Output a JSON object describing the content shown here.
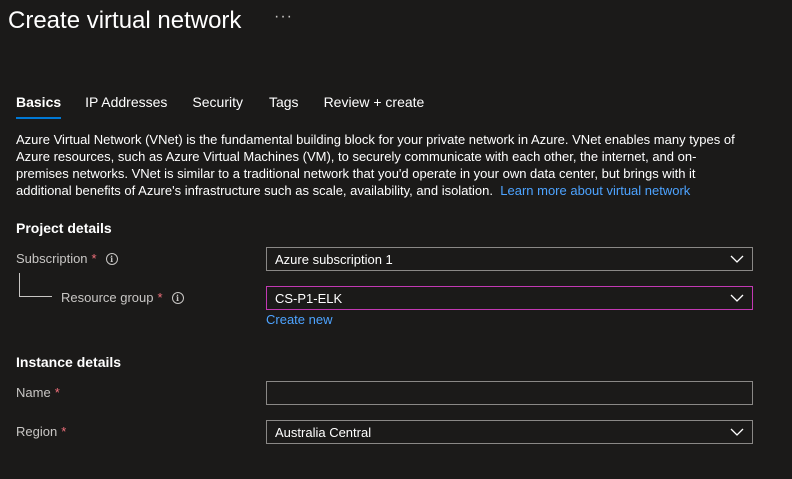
{
  "header": {
    "title": "Create virtual network",
    "more_label": "···"
  },
  "tabs": [
    {
      "label": "Basics",
      "active": true
    },
    {
      "label": "IP Addresses",
      "active": false
    },
    {
      "label": "Security",
      "active": false
    },
    {
      "label": "Tags",
      "active": false
    },
    {
      "label": "Review + create",
      "active": false
    }
  ],
  "description": {
    "text": "Azure Virtual Network (VNet) is the fundamental building block for your private network in Azure. VNet enables many types of Azure resources, such as Azure Virtual Machines (VM), to securely communicate with each other, the internet, and on-premises networks. VNet is similar to a traditional network that you'd operate in your own data center, but brings with it additional benefits of Azure's infrastructure such as scale, availability, and isolation.",
    "link": "Learn more about virtual network"
  },
  "project_details": {
    "heading": "Project details",
    "subscription": {
      "label": "Subscription",
      "required": "*",
      "value": "Azure subscription 1"
    },
    "resource_group": {
      "label": "Resource group",
      "required": "*",
      "value": "CS-P1-ELK",
      "create_new": "Create new"
    }
  },
  "instance_details": {
    "heading": "Instance details",
    "name": {
      "label": "Name",
      "required": "*",
      "value": "",
      "placeholder": ""
    },
    "region": {
      "label": "Region",
      "required": "*",
      "value": "Australia Central"
    }
  },
  "icons": {
    "info": "info-icon",
    "chevron": "chevron-down-icon",
    "more": "more-icon"
  },
  "colors": {
    "background": "#1b1a19",
    "accent": "#0078d4",
    "link": "#4da3ff",
    "required": "#f1707b",
    "focus_border": "#c239b3"
  }
}
